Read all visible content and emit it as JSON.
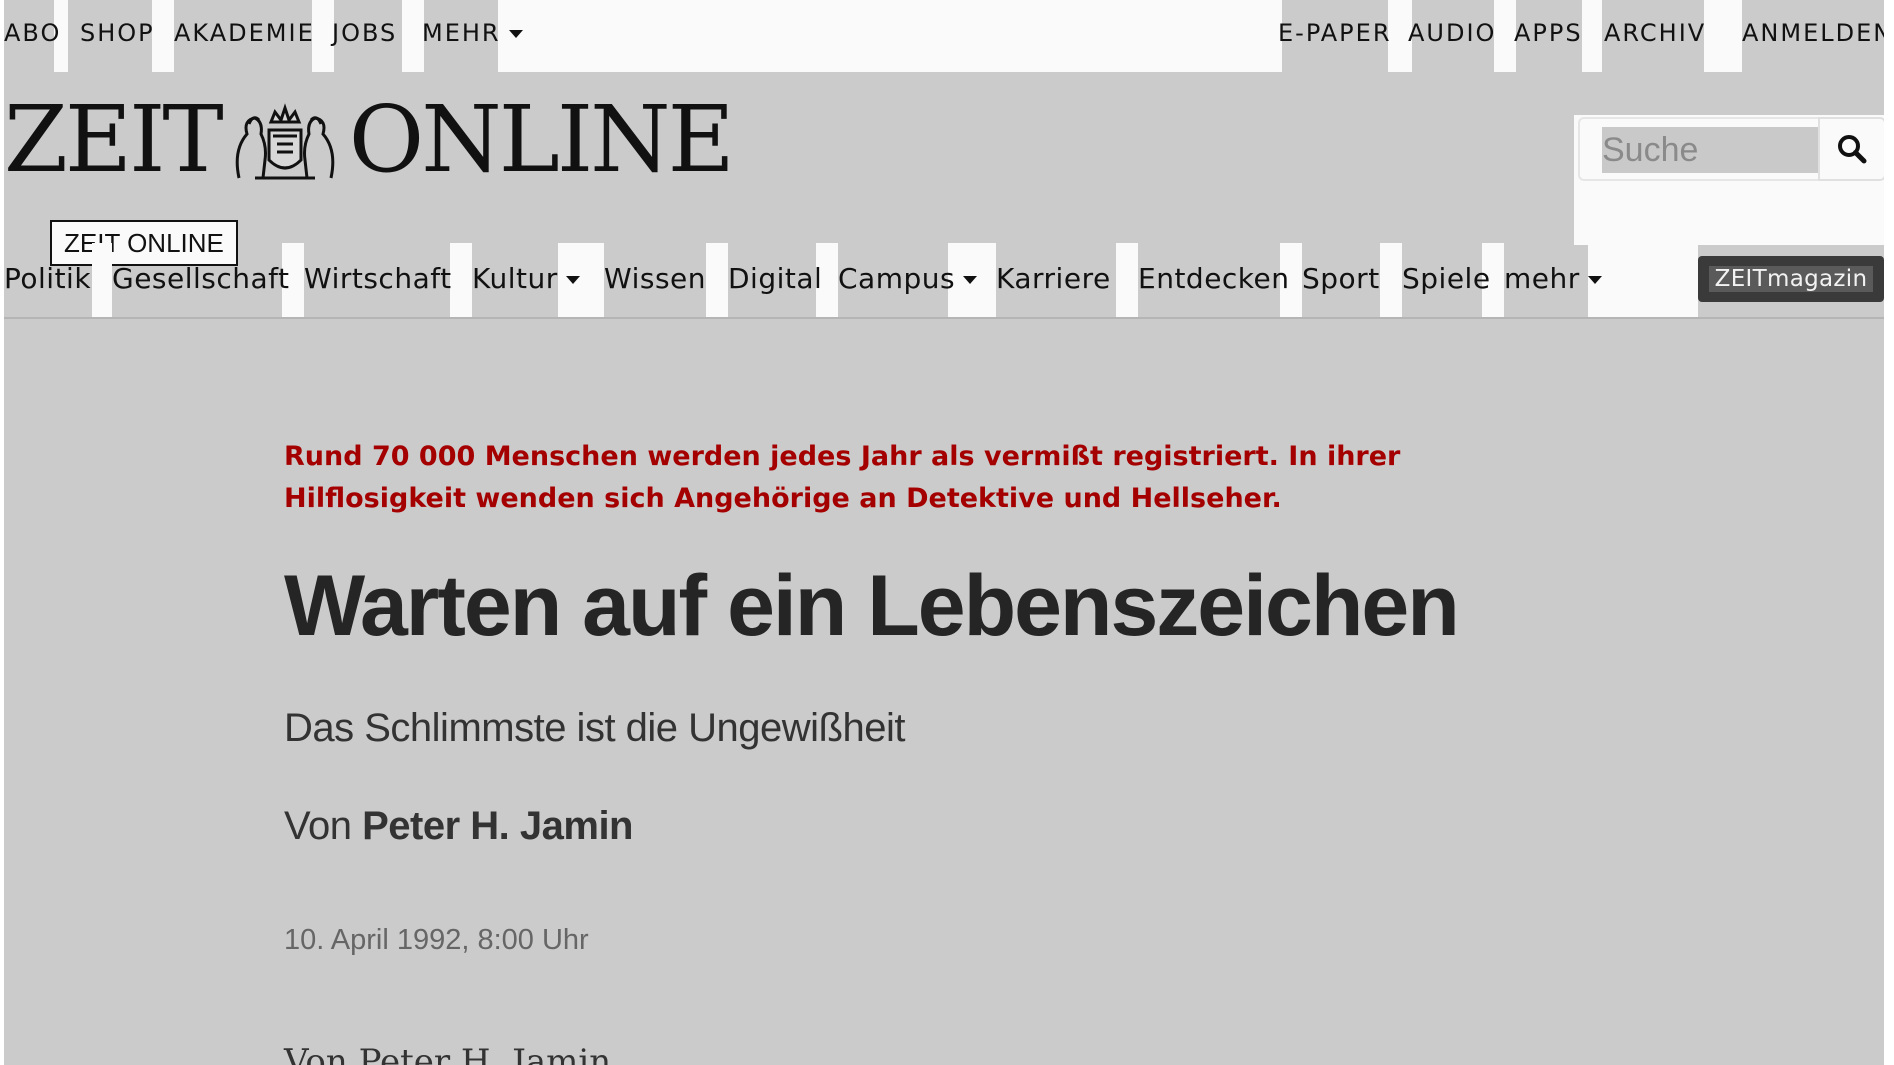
{
  "topbar": {
    "left_links": [
      "ABO",
      "SHOP",
      "AKADEMIE",
      "JOBS",
      "MEHR"
    ],
    "right_links": [
      "E-PAPER",
      "AUDIO",
      "APPS",
      "ARCHIV",
      "ANMELDEN"
    ]
  },
  "logo": {
    "left_text": "ZEIT",
    "right_text": "ONLINE"
  },
  "search": {
    "placeholder": "Suche"
  },
  "skip_tag": "ZEIT ONLINE",
  "nav": {
    "items": [
      "Politik",
      "Gesellschaft",
      "Wirtschaft",
      "Kultur",
      "Wissen",
      "Digital",
      "Campus",
      "Karriere",
      "Entdecken",
      "Sport",
      "Spiele",
      "mehr"
    ],
    "zeitmagazin": "ZEITmagazin"
  },
  "article": {
    "kicker": "Rund 70 000 Menschen werden jedes Jahr als vermißt registriert. In ihrer Hilflosigkeit wenden sich Angehörige an Detektive und Hellseher.",
    "headline": "Warten auf ein Lebenszeichen",
    "subhead": "Das Schlimmste ist die Ungewißheit",
    "byline_prefix": "Von",
    "author": "Peter H. Jamin",
    "date": "10. April 1992, 8:00 Uhr",
    "teaser_cut": "Von Peter H. Jamin"
  },
  "colors": {
    "kicker": "#a50000",
    "background": "#cbcbcb",
    "zeitmagazin_bg": "#3a3a3a"
  }
}
